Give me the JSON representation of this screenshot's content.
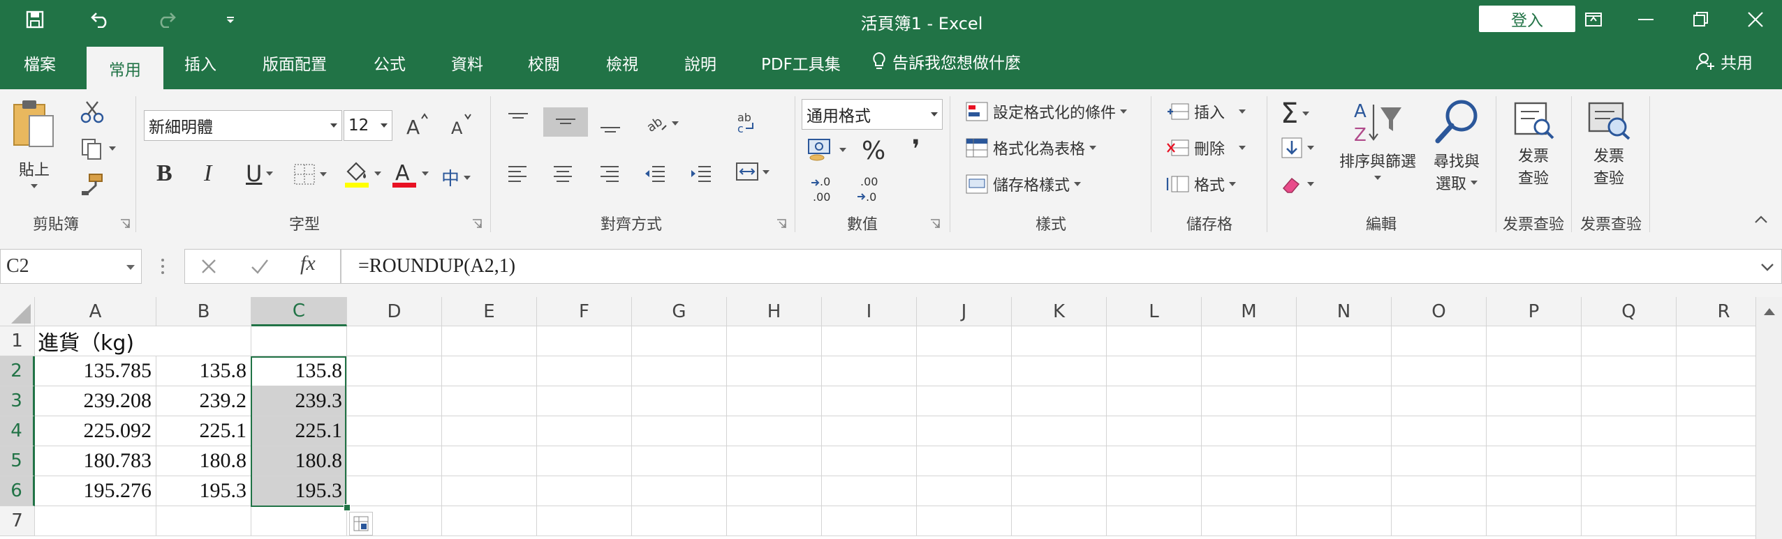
{
  "window": {
    "title": "活頁簿1  -  Excel",
    "login_label": "登入"
  },
  "tabs": [
    "檔案",
    "常用",
    "插入",
    "版面配置",
    "公式",
    "資料",
    "校閱",
    "檢視",
    "說明",
    "PDF工具集"
  ],
  "tell_me": "告訴我您想做什麼",
  "share": "共用",
  "ribbon": {
    "clipboard": {
      "paste": "貼上",
      "label": "剪貼簿"
    },
    "font": {
      "name": "新細明體",
      "size": "12",
      "bold": "B",
      "italic": "I",
      "underline": "U",
      "phonetic": "中",
      "label": "字型"
    },
    "alignment": {
      "label": "對齊方式"
    },
    "number": {
      "format": "通用格式",
      "percent": "%",
      "comma": "❜",
      "label": "數值"
    },
    "styles": {
      "conditional": "設定格式化的條件",
      "as_table": "格式化為表格",
      "cell_styles": "儲存格樣式",
      "label": "樣式"
    },
    "cells": {
      "insert": "插入",
      "delete": "刪除",
      "format": "格式",
      "label": "儲存格"
    },
    "editing": {
      "sort_filter": "排序與篩選",
      "find_l1": "尋找與",
      "find_l2": "選取",
      "label": "編輯"
    },
    "invoice1": {
      "l1": "发票",
      "l2": "查验",
      "label": "发票查验"
    },
    "invoice2": {
      "l1": "发票",
      "l2": "查验",
      "label": "发票查验"
    }
  },
  "formula_bar": {
    "name_box": "C2",
    "fx": "fx",
    "formula": "=ROUNDUP(A2,1)"
  },
  "grid": {
    "columns": [
      "A",
      "B",
      "C",
      "D",
      "E",
      "F",
      "G",
      "H",
      "I",
      "J",
      "K",
      "L",
      "M",
      "N",
      "O",
      "P",
      "Q",
      "R"
    ],
    "rows": [
      "1",
      "2",
      "3",
      "4",
      "5",
      "6",
      "7"
    ],
    "cells": {
      "A1": "進貨（kg)",
      "A2": "135.785",
      "B2": "135.8",
      "C2": "135.8",
      "A3": "239.208",
      "B3": "239.2",
      "C3": "239.3",
      "A4": "225.092",
      "B4": "225.1",
      "C4": "225.1",
      "A5": "180.783",
      "B5": "180.8",
      "C5": "180.8",
      "A6": "195.276",
      "B6": "195.3",
      "C6": "195.3"
    },
    "selection": "C2:C6"
  },
  "colors": {
    "brand": "#217346",
    "ribbon_bg": "#f3f3f3",
    "selection_fill": "#d2d2d2",
    "font_color_red": "#e81123",
    "highlight_yellow": "#ffff00"
  }
}
